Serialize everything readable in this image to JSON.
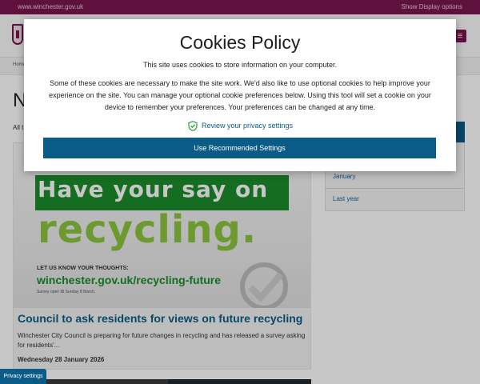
{
  "topbar": {
    "site": "www.winchester.gov.uk",
    "display": "Show Display options"
  },
  "header": {
    "logo": "winchester-crest-icon",
    "menu_icon": "menu-icon"
  },
  "breadcrumb": {
    "home": "Home"
  },
  "page": {
    "title": "N",
    "intro": "All t"
  },
  "sidebar": {
    "items": [
      "January",
      "Last year"
    ]
  },
  "article": {
    "image": {
      "line1": "Have your say on",
      "line2": "recycling.",
      "ask": "LET US KNOW YOUR THOUGHTS:",
      "url": "winchester.gov.uk/recycling-future",
      "closes": "Survey open till Sunday 8 March."
    },
    "title": "Council to ask residents for views on future recycling",
    "summary": "Winchester City Council is preparing for future changes in recycling and has released a survey asking for residents'...",
    "date": "Wednesday 28 January 2026"
  },
  "cookies": {
    "title": "Cookies Policy",
    "lead": "This site uses cookies to store information on your computer.",
    "body": "Some of these cookies are necessary to make the site work. We'd also like to use optional cookies to help improve your experience on the site. You can manage your optional cookie preferences below. Using this tool will set a cookie on your device to remember your preferences. Your preferences can be changed at any time.",
    "review_link": "Review your privacy settings",
    "review_icon": "shield-check-icon",
    "use_button": "Use Recommended Settings"
  },
  "privacy_tab": "Privacy settings",
  "colors": {
    "brand": "#7a1650",
    "primary": "#0a5b86",
    "green": "#1a8c2a",
    "lime": "#8cc63e"
  }
}
